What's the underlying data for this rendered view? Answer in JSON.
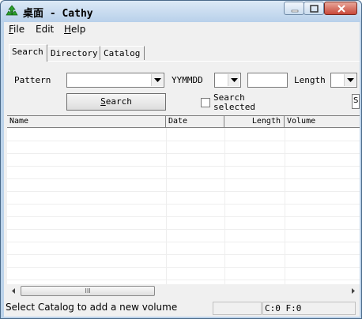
{
  "window": {
    "title": "桌面 - Cathy",
    "icon": "recycle-app-icon",
    "accent_color": "#2aa12a"
  },
  "menu": {
    "items": [
      {
        "label": "File",
        "mnemonic": "F",
        "rest": "ile"
      },
      {
        "label": "Edit",
        "mnemonic": "",
        "rest": "Edit"
      },
      {
        "label": "Help",
        "mnemonic": "H",
        "rest": "elp"
      }
    ]
  },
  "tabs": [
    {
      "label": "Search",
      "active": true
    },
    {
      "label": "Directory",
      "active": false
    },
    {
      "label": "Catalog",
      "active": false
    }
  ],
  "search": {
    "pattern_label": "Pattern",
    "pattern_value": "",
    "date_label": "YYMMDD",
    "date_value": "",
    "date_text_value": "",
    "length_label": "Length",
    "length_value": "",
    "button_mnemonic": "S",
    "button_rest": "earch",
    "search_selected_line1": "Search",
    "search_selected_line2": "selected",
    "search_selected_checked": false,
    "right_stub": "S"
  },
  "grid": {
    "columns": [
      "Name",
      "Date",
      "Length",
      "Volume"
    ],
    "rows": []
  },
  "scroll": {
    "thumb_grip": "III"
  },
  "status": {
    "message": "Select Catalog to add a new volume",
    "middle": "",
    "counts": "C:0 F:0"
  }
}
